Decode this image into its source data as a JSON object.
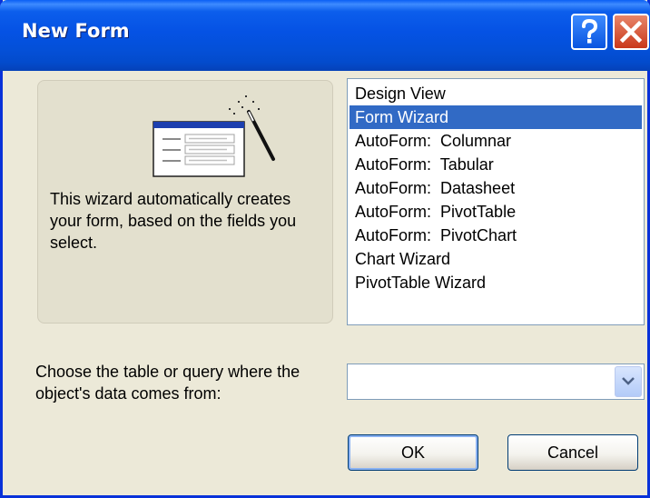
{
  "window": {
    "title": "New Form",
    "colors": {
      "titlebar": "#0552E4",
      "face": "#ECE9D8",
      "selection": "#316AC5",
      "close": "#D9532C"
    }
  },
  "titlebar_buttons": [
    {
      "name": "help",
      "icon": "question-mark-icon"
    },
    {
      "name": "close",
      "icon": "close-x-icon"
    }
  ],
  "preview": {
    "icon": "form-wizard-illustration-icon",
    "description": "This wizard automatically creates your form, based on the fields you select."
  },
  "view_list": {
    "items": [
      "Design View",
      "Form Wizard",
      "AutoForm:  Columnar",
      "AutoForm:  Tabular",
      "AutoForm:  Datasheet",
      "AutoForm:  PivotTable",
      "AutoForm:  PivotChart",
      "Chart Wizard",
      "PivotTable Wizard"
    ],
    "selected_index": 1
  },
  "source": {
    "label": "Choose the table or query where the object's data comes from:",
    "value": "",
    "icon": "chevron-down-icon"
  },
  "buttons": {
    "ok": "OK",
    "cancel": "Cancel"
  }
}
